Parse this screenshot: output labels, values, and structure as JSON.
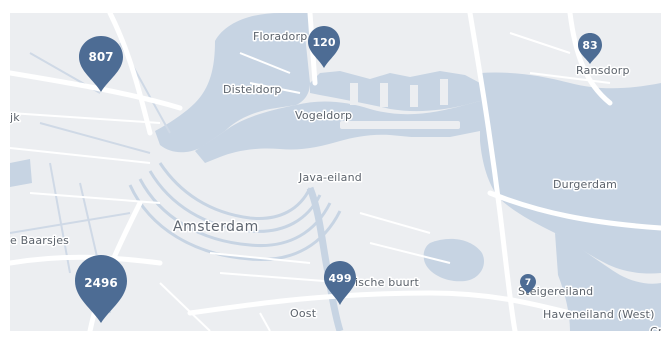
{
  "map": {
    "colors": {
      "water": "#c7d4e3",
      "land": "#eceef1",
      "road": "#ffffff",
      "minor_road": "#e4e7eb",
      "label": "#5c636c",
      "marker": "#4d6c94"
    },
    "place_labels": {
      "floradorp": "Floradorp",
      "disteldorp": "Disteldorp",
      "vogeldorp": "Vogeldorp",
      "java_eiland": "Java-eiland",
      "amsterdam": "Amsterdam",
      "baarsjes": "e Baarsjes",
      "oosterparkwijk": "ische buurt",
      "oost": "Oost",
      "ransdorp": "Ransdorp",
      "durgerdam": "Durgerdam",
      "steigereiland": "Steigereiland",
      "haveneiland": "Haveneiland (West)",
      "left_edge": "jk",
      "right_edge": "Cr"
    },
    "cluster_markers": [
      {
        "id": "cluster-807",
        "count": "807"
      },
      {
        "id": "cluster-120",
        "count": "120"
      },
      {
        "id": "cluster-83",
        "count": "83"
      },
      {
        "id": "cluster-2496",
        "count": "2496"
      },
      {
        "id": "cluster-499",
        "count": "499"
      },
      {
        "id": "cluster-7",
        "count": "7"
      }
    ]
  }
}
